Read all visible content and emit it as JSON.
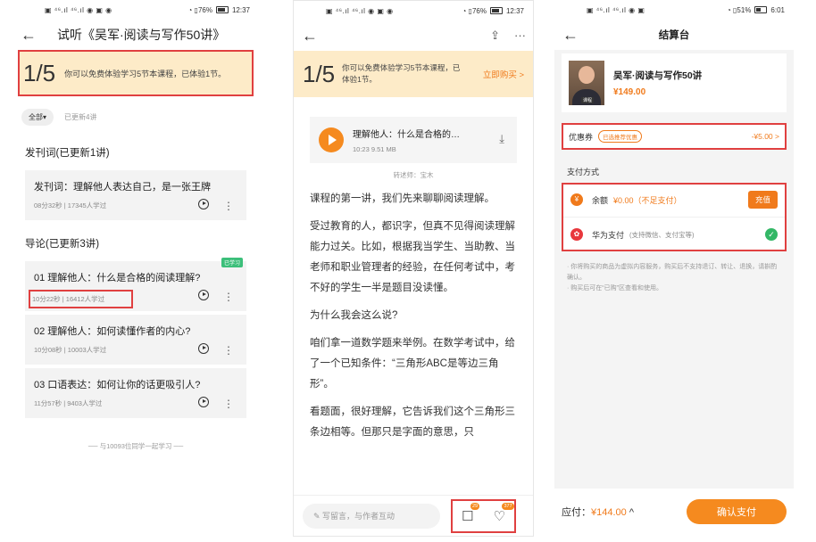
{
  "phone1": {
    "status": {
      "left": "▣ ⁴⁶.ıl ⁴⁶.ıl ◉ ▣ ◉",
      "right": "◔ ▯76%",
      "time": "12:37"
    },
    "title": "试听《吴军·阅读与写作50讲》",
    "trial": {
      "count": "1/5",
      "message": "你可以免费体验学习5节本课程，已体验1节。"
    },
    "filter": {
      "all_label": "全部▾",
      "updated": "已更新4讲"
    },
    "sections": [
      {
        "title": "发刊词(已更新1讲)",
        "items": [
          {
            "title": "发刊词：理解他人表达自己，是一张王牌",
            "meta": "08分32秒 | 17345人学过"
          }
        ]
      },
      {
        "title": "导论(已更新3讲)",
        "items": [
          {
            "title": "01 理解他人：什么是合格的阅读理解?",
            "meta": "10分22秒 | 16412人学过",
            "badge": "已学习"
          },
          {
            "title": "02 理解他人：如何读懂作者的内心?",
            "meta": "10分08秒 | 10003人学过"
          },
          {
            "title": "03 口语表达：如何让你的话更吸引人?",
            "meta": "11分57秒 | 9403人学过"
          }
        ]
      }
    ],
    "footer": "── 与10093位同学一起学习 ──"
  },
  "phone2": {
    "status": {
      "left": "▣ ⁴⁶.ıl ⁴⁶.ıl ◉ ▣ ◉",
      "right": "◔ ▯76%",
      "time": "12:37"
    },
    "trial": {
      "count": "1/5",
      "message": "你可以免费体验学习5节本课程，已体验1节。",
      "buy": "立即购买 >"
    },
    "audio": {
      "title": "理解他人：什么是合格的…",
      "meta": "10:23   9.51 MB"
    },
    "narrator": "转述师：宝木",
    "paragraphs": [
      "课程的第一讲，我们先来聊聊阅读理解。",
      "受过教育的人，都识字，但真不见得阅读理解能力过关。比如，根据我当学生、当助教、当老师和职业管理者的经验，在任何考试中，考不好的学生一半是题目没读懂。",
      "为什么我会这么说?",
      "咱们拿一道数学题来举例。在数学考试中，给了一个已知条件：“三角形ABC是等边三角形”。",
      "看题面，很好理解，它告诉我们这个三角形三条边相等。但那只是字面的意思，只"
    ],
    "comment_placeholder": "✎ 写留言，与作者互动",
    "comment_count": "29",
    "like_count": "377"
  },
  "phone3": {
    "status": {
      "left": "▣ ⁴⁶.ıl ⁴⁶.ıl ◉ ▣",
      "right": "◔ ▯51%",
      "time": "6:01"
    },
    "title": "结算台",
    "product": {
      "name": "吴军·阅读与写作50讲",
      "price": "¥149.00",
      "tag": "课程"
    },
    "coupon": {
      "label": "优惠券",
      "tag": "已选推荐优惠",
      "amount": "-¥5.00  >"
    },
    "pay_label": "支付方式",
    "balance": {
      "icon": "¥",
      "label": "余额",
      "amount": "¥0.00（不足支付）",
      "action": "充值"
    },
    "huawei": {
      "label": "华为支付",
      "sub": "(支持微信、支付宝等)"
    },
    "notes": [
      "· 你将购买的商品为虚拟内容服务，购买后不支持退订、转让、退换，请斟酌确认。",
      "· 购买后可在“已购”区查看和使用。"
    ],
    "due": {
      "label": "应付：",
      "amount": "¥144.00",
      "caret": "^"
    },
    "confirm": "确认支付"
  },
  "colors": {
    "accent": "#f07a1b",
    "highlight_box": "#e04040",
    "trial_bg": "#fdebc8",
    "success": "#33b766"
  }
}
